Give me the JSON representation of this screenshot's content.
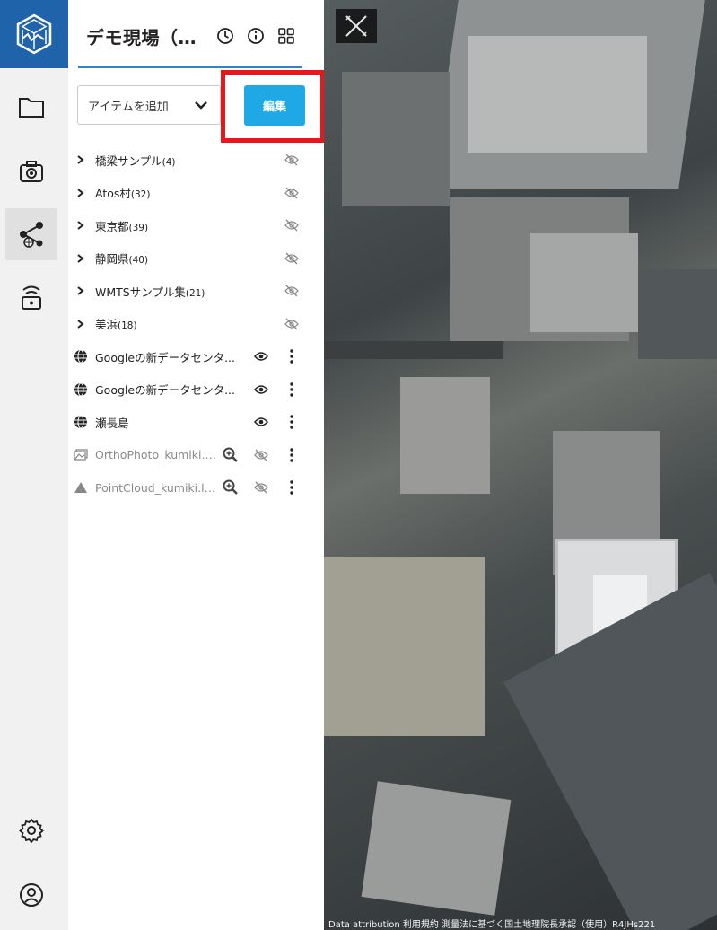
{
  "app": {
    "project_title": "デモ現場（公...",
    "accent_color": "#1f64ab",
    "highlight_color": "#e8171b"
  },
  "rail": {
    "items": [
      {
        "name": "folder-icon",
        "active": false
      },
      {
        "name": "camera-icon",
        "active": false
      },
      {
        "name": "share-network-icon",
        "active": true
      },
      {
        "name": "device-icon",
        "active": false
      },
      {
        "name": "settings-gear-icon",
        "active": false
      },
      {
        "name": "account-icon",
        "active": false
      }
    ]
  },
  "toolbar": {
    "add_item_label": "アイテムを追加",
    "edit_label": "編集"
  },
  "tree": {
    "groups": [
      {
        "label": "橋梁サンプル",
        "count": "(4)",
        "visible": false
      },
      {
        "label": "Atos村",
        "count": "(32)",
        "visible": false
      },
      {
        "label": "東京都",
        "count": "(39)",
        "visible": false
      },
      {
        "label": "静岡県",
        "count": "(40)",
        "visible": false
      },
      {
        "label": "WMTSサンプル集",
        "count": "(21)",
        "visible": false
      },
      {
        "label": "美浜",
        "count": "(18)",
        "visible": false
      }
    ],
    "items": [
      {
        "label": "Googleの新データセンタ...",
        "icon": "globe-icon",
        "visible": true
      },
      {
        "label": "Googleの新データセンタ...",
        "icon": "globe-icon",
        "visible": true
      },
      {
        "label": "瀬長島",
        "icon": "globe-icon",
        "visible": true
      },
      {
        "label": "OrthoPhoto_kumiki.tif",
        "icon": "image-icon",
        "visible": false
      },
      {
        "label": "PointCloud_kumiki.laz",
        "icon": "pointcloud-icon",
        "visible": false
      }
    ]
  },
  "map": {
    "attribution": "Data attribution  利用規約 測量法に基づく国土地理院長承認（使用）R4JHs221"
  }
}
